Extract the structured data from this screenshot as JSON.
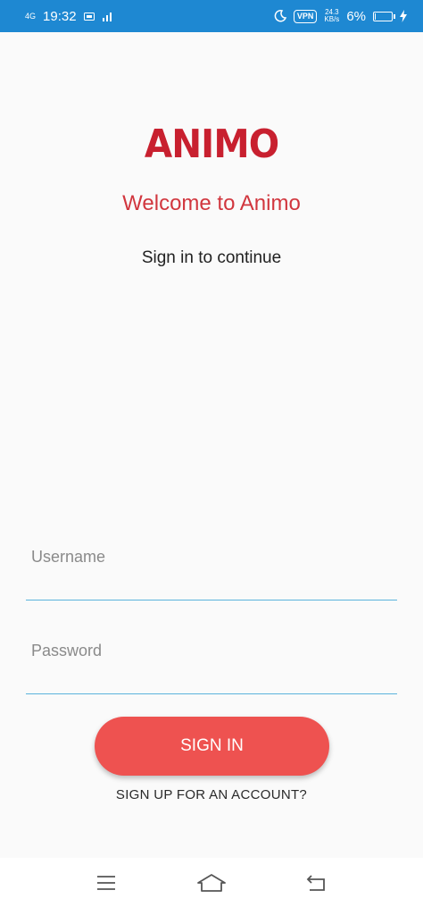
{
  "status_bar": {
    "network": "4G",
    "time": "19:32",
    "vpn": "VPN",
    "speed_value": "24.3",
    "speed_unit": "KB/s",
    "battery_percent": "6%",
    "battery_level": 0.06
  },
  "app": {
    "logo": "ANIMO",
    "welcome": "Welcome to Animo",
    "subtitle": "Sign in to continue"
  },
  "form": {
    "username_placeholder": "Username",
    "username_value": "",
    "password_placeholder": "Password",
    "password_value": "",
    "signin_label": "SIGN IN",
    "signup_label": "SIGN UP FOR AN ACCOUNT?"
  },
  "colors": {
    "status_bar": "#1e88d2",
    "logo": "#c8202f",
    "welcome": "#d1363e",
    "button": "#ee5250",
    "field_underline": "#5ab3dc"
  },
  "icons": {
    "nav_menu": "menu-icon",
    "nav_home": "home-icon",
    "nav_back": "back-icon"
  }
}
